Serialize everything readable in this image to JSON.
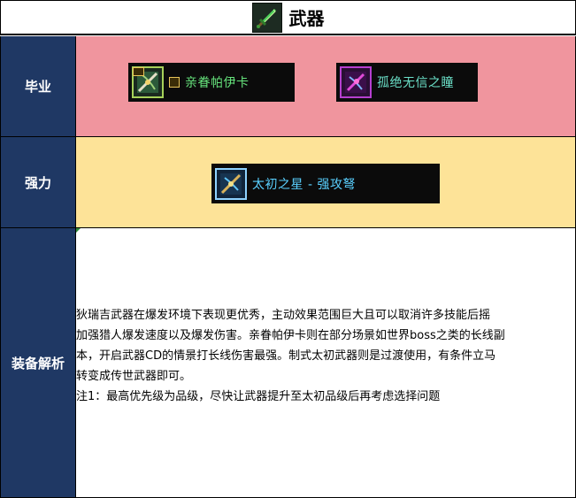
{
  "title": "武器",
  "icons": {
    "title": "sword-icon",
    "item_graduate_1": "crossbow-icon",
    "item_graduate_2": "bow-icon",
    "item_strong_1": "crossbow-icon"
  },
  "rows": {
    "graduate": {
      "label": "毕业",
      "items": [
        {
          "name": "亲眷帕伊卡"
        },
        {
          "name": "孤绝无信之瞳"
        }
      ]
    },
    "strong": {
      "label": "强力",
      "items": [
        {
          "name": "太初之星 - 强攻弩"
        }
      ]
    },
    "analysis": {
      "label": "装备解析",
      "lines": [
        "狄瑞吉武器在爆发环境下表现更优秀，主动效果范围巨大且可以取消许多技能后摇",
        "加强猎人爆发速度以及爆发伤害。亲眷帕伊卡则在部分场景如世界boss之类的长线副",
        "本，开启武器CD的情景打长线伤害最强。制式太初武器则是过渡使用，有条件立马",
        "转变成传世武器即可。",
        "注1：最高优先级为品级，尽快让武器提升至太初品级后再考虑选择问题"
      ]
    }
  },
  "colors": {
    "label_bg": "#1f3864",
    "graduate_bg": "#f0959e",
    "strong_bg": "#fde398"
  }
}
